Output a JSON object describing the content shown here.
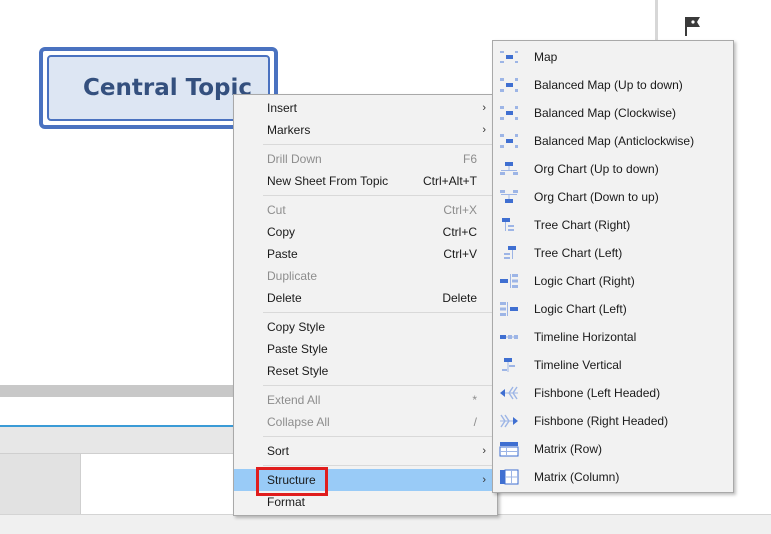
{
  "topic": {
    "label": "Central Topic"
  },
  "context_menu": {
    "items": [
      {
        "label": "Insert",
        "shortcut": "",
        "submenu": true,
        "disabled": false
      },
      {
        "label": "Markers",
        "shortcut": "",
        "submenu": true,
        "disabled": false
      },
      {
        "label": "Drill Down",
        "shortcut": "F6",
        "submenu": false,
        "disabled": true
      },
      {
        "label": "New Sheet From Topic",
        "shortcut": "Ctrl+Alt+T",
        "submenu": false,
        "disabled": false
      },
      {
        "label": "Cut",
        "shortcut": "Ctrl+X",
        "submenu": false,
        "disabled": true
      },
      {
        "label": "Copy",
        "shortcut": "Ctrl+C",
        "submenu": false,
        "disabled": false
      },
      {
        "label": "Paste",
        "shortcut": "Ctrl+V",
        "submenu": false,
        "disabled": false
      },
      {
        "label": "Duplicate",
        "shortcut": "",
        "submenu": false,
        "disabled": true
      },
      {
        "label": "Delete",
        "shortcut": "Delete",
        "submenu": false,
        "disabled": false
      },
      {
        "label": "Copy Style",
        "shortcut": "",
        "submenu": false,
        "disabled": false
      },
      {
        "label": "Paste Style",
        "shortcut": "",
        "submenu": false,
        "disabled": false
      },
      {
        "label": "Reset Style",
        "shortcut": "",
        "submenu": false,
        "disabled": false
      },
      {
        "label": "Extend All",
        "shortcut": "*",
        "submenu": false,
        "disabled": true
      },
      {
        "label": "Collapse All",
        "shortcut": "/",
        "submenu": false,
        "disabled": true
      },
      {
        "label": "Sort",
        "shortcut": "",
        "submenu": true,
        "disabled": false
      },
      {
        "label": "Structure",
        "shortcut": "",
        "submenu": true,
        "disabled": false,
        "highlighted": true
      },
      {
        "label": "Format",
        "shortcut": "",
        "submenu": false,
        "disabled": false
      }
    ],
    "submenu_arrow": "›"
  },
  "structure_submenu": {
    "items": [
      {
        "label": "Map",
        "icon": "map-structure-icon"
      },
      {
        "label": "Balanced Map (Up to down)",
        "icon": "balanced-map-icon"
      },
      {
        "label": "Balanced Map (Clockwise)",
        "icon": "balanced-map-clockwise-icon"
      },
      {
        "label": "Balanced Map (Anticlockwise)",
        "icon": "balanced-map-anticlockwise-icon"
      },
      {
        "label": "Org Chart (Up to down)",
        "icon": "org-chart-down-icon"
      },
      {
        "label": "Org Chart (Down to up)",
        "icon": "org-chart-up-icon"
      },
      {
        "label": "Tree Chart (Right)",
        "icon": "tree-chart-right-icon"
      },
      {
        "label": "Tree Chart (Left)",
        "icon": "tree-chart-left-icon"
      },
      {
        "label": "Logic Chart (Right)",
        "icon": "logic-chart-right-icon"
      },
      {
        "label": "Logic Chart (Left)",
        "icon": "logic-chart-left-icon"
      },
      {
        "label": "Timeline Horizontal",
        "icon": "timeline-horizontal-icon"
      },
      {
        "label": "Timeline Vertical",
        "icon": "timeline-vertical-icon"
      },
      {
        "label": "Fishbone (Left Headed)",
        "icon": "fishbone-left-icon"
      },
      {
        "label": "Fishbone (Right Headed)",
        "icon": "fishbone-right-icon"
      },
      {
        "label": "Matrix (Row)",
        "icon": "matrix-row-icon"
      },
      {
        "label": "Matrix (Column)",
        "icon": "matrix-column-icon"
      }
    ]
  },
  "toolbar": {
    "flag_icon": "flag-icon"
  },
  "colors": {
    "topic_border": "#4a72c0",
    "topic_fill": "#dde6f3",
    "topic_text": "#34507e",
    "menu_highlight": "#99cbf7",
    "annotation_box": "#e01d1d",
    "icon_blue": "#3f6fd1"
  }
}
